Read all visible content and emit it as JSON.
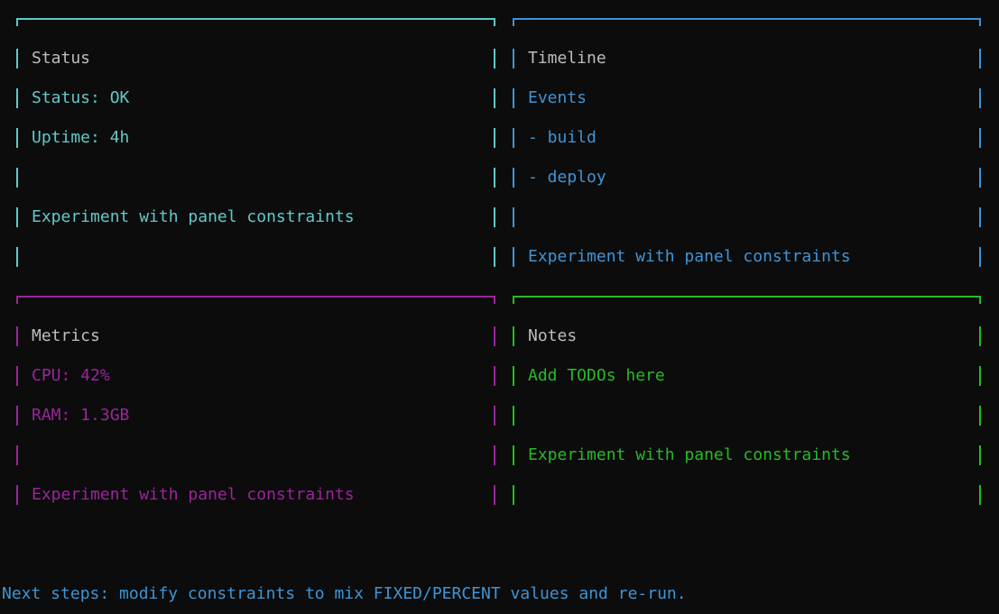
{
  "panels": {
    "status": {
      "title": "Status",
      "lines": [
        "Status: OK",
        "Uptime: 4h",
        "",
        "Experiment with panel constraints",
        ""
      ]
    },
    "timeline": {
      "title": "Timeline",
      "lines": [
        "Events",
        "- build",
        "- deploy",
        "",
        "Experiment with panel constraints"
      ]
    },
    "metrics": {
      "title": "Metrics",
      "lines": [
        "CPU: 42%",
        "RAM: 1.3GB",
        "",
        "Experiment with panel constraints"
      ]
    },
    "notes": {
      "title": "Notes",
      "lines": [
        "Add TODOs here",
        "",
        "Experiment with panel constraints",
        ""
      ]
    }
  },
  "footer": {
    "text": "Next steps: modify constraints to mix FIXED/PERCENT values and re-run."
  },
  "colors": {
    "background": "#0c0c0c",
    "status": "#61c9c9",
    "timeline": "#3f94d6",
    "metrics": "#9c249c",
    "notes": "#25bb25",
    "title": "#bdbdbd"
  }
}
